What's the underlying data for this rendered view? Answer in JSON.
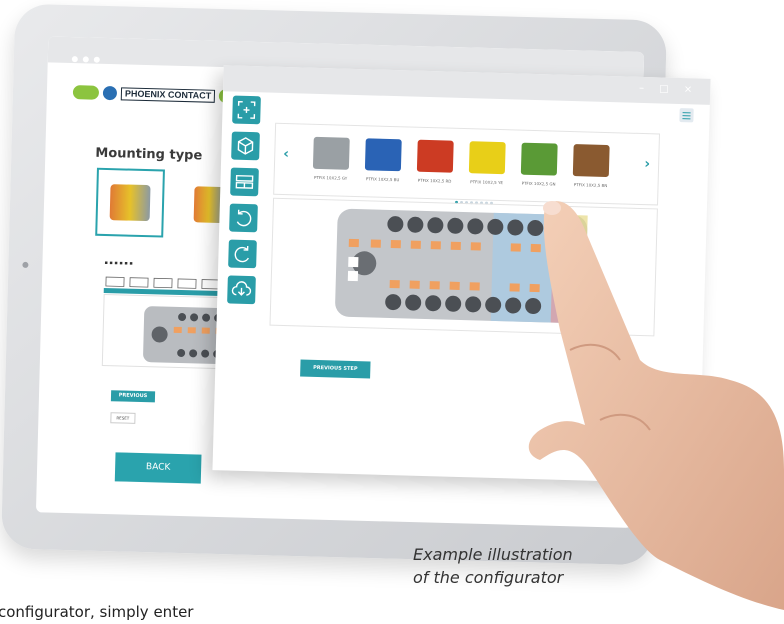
{
  "tablet": {
    "brand_logo_text": "PHOENIX CONTACT",
    "section_title": "Mounting type",
    "prior_step_btn": "PREVIOUS STEP",
    "reset_btn": "RESET",
    "back_btn": "BACK"
  },
  "configurator": {
    "window_controls": "– □ ×",
    "toolbar_icons": [
      "fit-screen-icon",
      "cube-view-icon",
      "layout-icon",
      "undo-icon",
      "redo-icon",
      "download-icon"
    ],
    "products": [
      {
        "label": "PTFIX 10X2,5 GY",
        "color": "#9aa0a4"
      },
      {
        "label": "PTFIX 10X2,5 BU",
        "color": "#2a63b5"
      },
      {
        "label": "PTFIX 10X2,5 RD",
        "color": "#cc3b23"
      },
      {
        "label": "PTFIX 10X2,5 YE",
        "color": "#e8cf18"
      },
      {
        "label": "PTFIX 10X2,5 GN",
        "color": "#5a9a36"
      },
      {
        "label": "PTFIX 10X2,5 BN",
        "color": "#8a5a30"
      }
    ],
    "previous_step_btn": "PREVIOUS STEP"
  },
  "caption": [
    "Example illustration",
    "of the configurator"
  ],
  "footer_text": "configurator, simply enter",
  "colors": {
    "accent": "#2a9da8",
    "logo_green": "#8cc43f",
    "logo_blue": "#2a6fb3"
  }
}
